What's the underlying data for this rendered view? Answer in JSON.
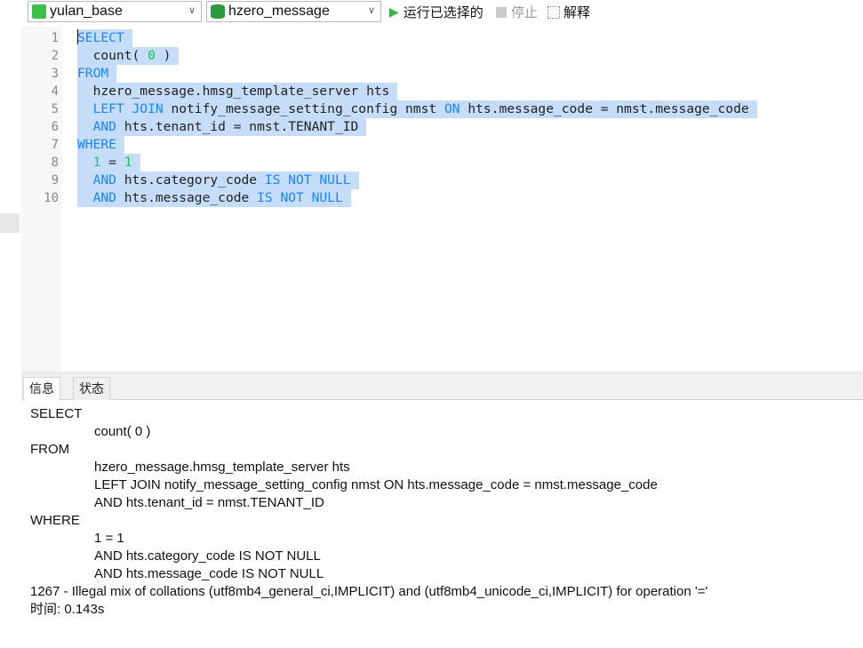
{
  "toolbar": {
    "connection": "yulan_base",
    "database": "hzero_message",
    "run_selected": "运行已选择的",
    "stop": "停止",
    "explain": "解释"
  },
  "colors": {
    "selection": "#c5ddf8",
    "keyword": "#1a84ff",
    "number": "#16c25a",
    "connection_icon": "#3cc04a",
    "db_icon": "#2a9d3a",
    "run": "#3cb043"
  },
  "editor": {
    "line_numbers": [
      "1",
      "2",
      "3",
      "4",
      "5",
      "6",
      "7",
      "8",
      "9",
      "10"
    ],
    "lines": [
      [
        {
          "t": "SELECT",
          "c": "kw"
        }
      ],
      [
        {
          "t": "  count( "
        },
        {
          "t": "0",
          "c": "num"
        },
        {
          "t": " )"
        }
      ],
      [
        {
          "t": "FROM",
          "c": "kw"
        }
      ],
      [
        {
          "t": "  hzero_message.hmsg_template_server hts"
        }
      ],
      [
        {
          "t": "  "
        },
        {
          "t": "LEFT JOIN",
          "c": "kw"
        },
        {
          "t": " notify_message_setting_config nmst "
        },
        {
          "t": "ON",
          "c": "kw"
        },
        {
          "t": " hts.message_code = nmst.message_code"
        }
      ],
      [
        {
          "t": "  "
        },
        {
          "t": "AND",
          "c": "kw"
        },
        {
          "t": " hts.tenant_id = nmst.TENANT_ID"
        }
      ],
      [
        {
          "t": "WHERE",
          "c": "kw"
        }
      ],
      [
        {
          "t": "  "
        },
        {
          "t": "1",
          "c": "num"
        },
        {
          "t": " = "
        },
        {
          "t": "1",
          "c": "num"
        }
      ],
      [
        {
          "t": "  "
        },
        {
          "t": "AND",
          "c": "kw"
        },
        {
          "t": " hts.category_code "
        },
        {
          "t": "IS NOT NULL",
          "c": "kw"
        }
      ],
      [
        {
          "t": "  "
        },
        {
          "t": "AND",
          "c": "kw"
        },
        {
          "t": " hts.message_code "
        },
        {
          "t": "IS NOT NULL",
          "c": "kw"
        }
      ]
    ]
  },
  "tabs": [
    "信息",
    "状态"
  ],
  "info": {
    "lines": [
      {
        "text": "SELECT",
        "indent": false
      },
      {
        "text": "count( 0 )",
        "indent": true
      },
      {
        "text": "FROM",
        "indent": false
      },
      {
        "text": "hzero_message.hmsg_template_server hts",
        "indent": true
      },
      {
        "text": "LEFT JOIN notify_message_setting_config nmst ON hts.message_code = nmst.message_code",
        "indent": true
      },
      {
        "text": "AND hts.tenant_id = nmst.TENANT_ID",
        "indent": true
      },
      {
        "text": "WHERE",
        "indent": false
      },
      {
        "text": "1 = 1",
        "indent": true
      },
      {
        "text": "AND hts.category_code IS NOT NULL",
        "indent": true
      },
      {
        "text": "AND hts.message_code IS NOT NULL",
        "indent": true
      },
      {
        "text": "1267 - Illegal mix of collations (utf8mb4_general_ci,IMPLICIT) and (utf8mb4_unicode_ci,IMPLICIT) for operation '='",
        "indent": false
      },
      {
        "text": "时间: 0.143s",
        "indent": false
      }
    ]
  }
}
